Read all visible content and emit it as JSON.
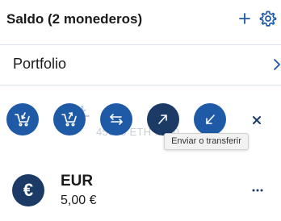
{
  "header": {
    "title": "Saldo (2 monederos)",
    "add_icon": "plus-icon",
    "settings_icon": "gear-icon"
  },
  "portfolio": {
    "label": "Portfolio",
    "chevron_icon": "chevron-right-icon"
  },
  "ghost_wallet": {
    "symbol": "Ł",
    "value": "45093 ETH ... 50"
  },
  "actions": [
    {
      "icon": "cart-buy-icon",
      "active": false
    },
    {
      "icon": "cart-sell-icon",
      "active": false
    },
    {
      "icon": "exchange-arrows-icon",
      "active": false
    },
    {
      "icon": "arrow-up-right-icon",
      "active": true
    },
    {
      "icon": "arrow-down-left-icon",
      "active": false
    }
  ],
  "tooltip": {
    "text": "Enviar o transferir"
  },
  "close_icon": "close-icon",
  "wallet": {
    "currency_symbol": "€",
    "code": "EUR",
    "balance": "5,00 €",
    "more_icon": "more-dots-icon"
  },
  "colors": {
    "accent": "#1f5aa6",
    "accent_dark": "#1b3a66",
    "divider": "#dde3ec",
    "ghost_text": "#c8ced8"
  }
}
